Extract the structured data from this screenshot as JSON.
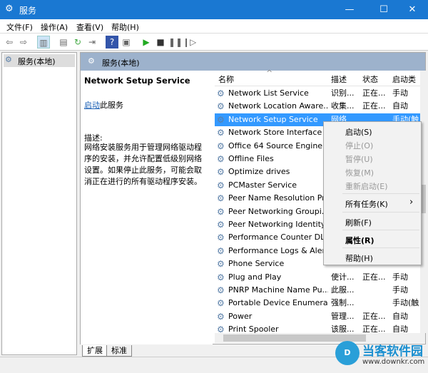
{
  "window": {
    "title": "服务",
    "min": "—",
    "max": "☐",
    "close": "✕"
  },
  "menu": [
    "文件(F)",
    "操作(A)",
    "查看(V)",
    "帮助(H)"
  ],
  "tree": {
    "root": "服务(本地)"
  },
  "pane_header": "服务(本地)",
  "details": {
    "service_name": "Network Setup Service",
    "start_link": "启动",
    "start_suffix": "此服务",
    "desc_label": "描述:",
    "desc_text": "网络安装服务用于管理网络驱动程序的安装，并允许配置低级别网络设置。如果停止此服务，可能会取消正在进行的所有驱动程序安装。"
  },
  "columns": {
    "name": "名称",
    "desc": "描述",
    "status": "状态",
    "startup": "启动类"
  },
  "rows": [
    {
      "name": "Network List Service",
      "desc": "识别...",
      "status": "正在...",
      "startup": "手动"
    },
    {
      "name": "Network Location Aware...",
      "desc": "收集...",
      "status": "正在...",
      "startup": "自动"
    },
    {
      "name": "Network Setup Service",
      "desc": "网络",
      "status": "",
      "startup": "手动(触"
    },
    {
      "name": "Network Store Interface ...",
      "desc": "",
      "status": "",
      "startup": ""
    },
    {
      "name": "Office 64 Source Engine",
      "desc": "",
      "status": "",
      "startup": ""
    },
    {
      "name": "Offline Files",
      "desc": "",
      "status": "",
      "startup": ""
    },
    {
      "name": "Optimize drives",
      "desc": "",
      "status": "",
      "startup": ""
    },
    {
      "name": "PCMaster Service",
      "desc": "",
      "status": "",
      "startup": ""
    },
    {
      "name": "Peer Name Resolution Pr...",
      "desc": "",
      "status": "",
      "startup": ""
    },
    {
      "name": "Peer Networking Groupi...",
      "desc": "",
      "status": "",
      "startup": ""
    },
    {
      "name": "Peer Networking Identity...",
      "desc": "",
      "status": "",
      "startup": ""
    },
    {
      "name": "Performance Counter DL...",
      "desc": "",
      "status": "",
      "startup": ""
    },
    {
      "name": "Performance Logs & Aler...",
      "desc": "",
      "status": "",
      "startup": ""
    },
    {
      "name": "Phone Service",
      "desc": "",
      "status": "",
      "startup": ""
    },
    {
      "name": "Plug and Play",
      "desc": "使计...",
      "status": "正在...",
      "startup": "手动"
    },
    {
      "name": "PNRP Machine Name Pu...",
      "desc": "此服...",
      "status": "",
      "startup": "手动"
    },
    {
      "name": "Portable Device Enumera...",
      "desc": "强制...",
      "status": "",
      "startup": "手动(触"
    },
    {
      "name": "Power",
      "desc": "管理...",
      "status": "正在...",
      "startup": "自动"
    },
    {
      "name": "Print Spooler",
      "desc": "该服...",
      "status": "正在...",
      "startup": "自动"
    }
  ],
  "context_menu": {
    "start": "启动(S)",
    "stop": "停止(O)",
    "pause": "暂停(U)",
    "resume": "恢复(M)",
    "restart": "重新启动(E)",
    "all_tasks": "所有任务(K)",
    "refresh": "刷新(F)",
    "properties": "属性(R)",
    "help": "帮助(H)",
    "arrow": "›"
  },
  "tabs": [
    "扩展",
    "标准"
  ],
  "watermark": {
    "brand": "当客软件园",
    "url": "www.downkr.com"
  }
}
